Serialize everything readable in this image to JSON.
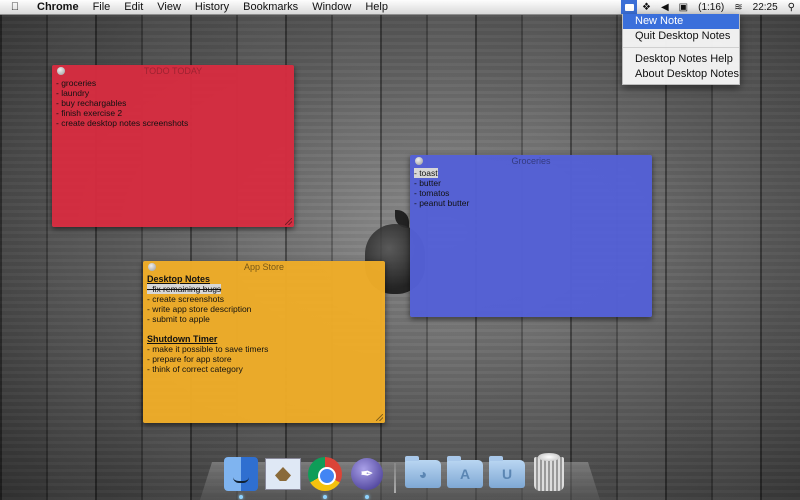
{
  "menubar": {
    "app_name": "Chrome",
    "menus": [
      "File",
      "Edit",
      "View",
      "History",
      "Bookmarks",
      "Window",
      "Help"
    ],
    "battery": "(1:16)",
    "clock": "22:25",
    "icons": [
      "apple-icon",
      "desktop-notes-icon",
      "dropbox-icon",
      "volume-icon",
      "battery-icon",
      "wifi-icon",
      "spotlight-icon"
    ]
  },
  "dropdown": {
    "items": [
      "New Note",
      "Quit Desktop Notes",
      "Desktop Notes Help",
      "About Desktop Notes"
    ]
  },
  "notes": {
    "red": {
      "title": "TODO TODAY",
      "lines": [
        "- groceries",
        "- laundry",
        "- buy rechargables",
        "- finish exercise 2",
        "- create desktop notes screenshots"
      ],
      "color": "#d62c40"
    },
    "blue": {
      "title": "Groceries",
      "lines": [
        "- toast",
        "- butter",
        "- tomatos",
        "- peanut butter"
      ],
      "color": "#5460d6"
    },
    "orange": {
      "title": "App Store",
      "heading1": "Desktop Notes",
      "lines1": [
        "- fix remaining bugs",
        "- create screenshots",
        "- write app store description",
        "- submit to apple"
      ],
      "heading2": "Shutdown Timer",
      "lines2": [
        "- make it possible to save timers",
        "- prepare for app store",
        "- think of correct category"
      ],
      "color": "#eeac28"
    }
  },
  "dock": {
    "apps": [
      "finder-icon",
      "mail-icon",
      "chrome-icon",
      "pen-app-icon"
    ],
    "stacks": [
      "applications-folder-icon",
      "appstore-folder-icon",
      "utilities-folder-icon",
      "trash-icon"
    ]
  }
}
